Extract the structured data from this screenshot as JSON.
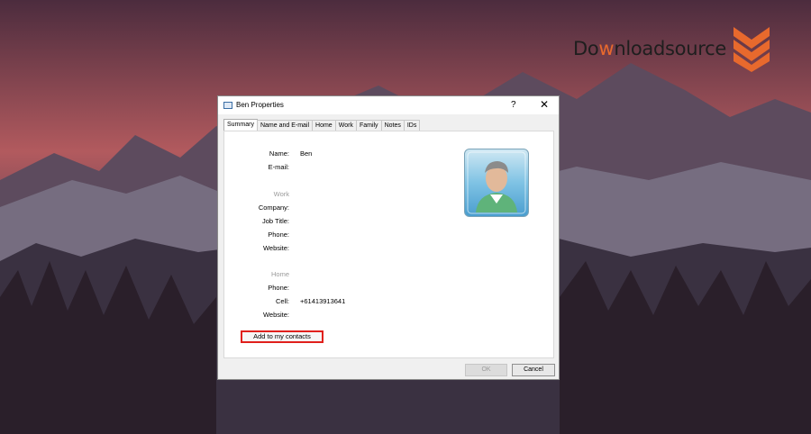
{
  "logo": {
    "prefix": "Do",
    "highlight": "w",
    "middle": "nload",
    "suffix": "source"
  },
  "dialog": {
    "title": "Ben Properties",
    "help_label": "?",
    "close_label": "✕",
    "tabs": [
      {
        "label": "Summary",
        "active": true
      },
      {
        "label": "Name and E-mail",
        "active": false
      },
      {
        "label": "Home",
        "active": false
      },
      {
        "label": "Work",
        "active": false
      },
      {
        "label": "Family",
        "active": false
      },
      {
        "label": "Notes",
        "active": false
      },
      {
        "label": "IDs",
        "active": false
      }
    ],
    "summary": {
      "name_label": "Name:",
      "name_value": "Ben",
      "email_label": "E-mail:",
      "email_value": "",
      "work_header": "Work",
      "company_label": "Company:",
      "job_title_label": "Job Title:",
      "work_phone_label": "Phone:",
      "work_website_label": "Website:",
      "home_header": "Home",
      "home_phone_label": "Phone:",
      "cell_label": "Cell:",
      "cell_value": "+61413913641",
      "home_website_label": "Website:"
    },
    "add_button": "Add to my contacts",
    "ok_button": "OK",
    "cancel_button": "Cancel"
  },
  "colors": {
    "accent_logo": "#e8692d",
    "highlight_border": "#e0201c"
  }
}
